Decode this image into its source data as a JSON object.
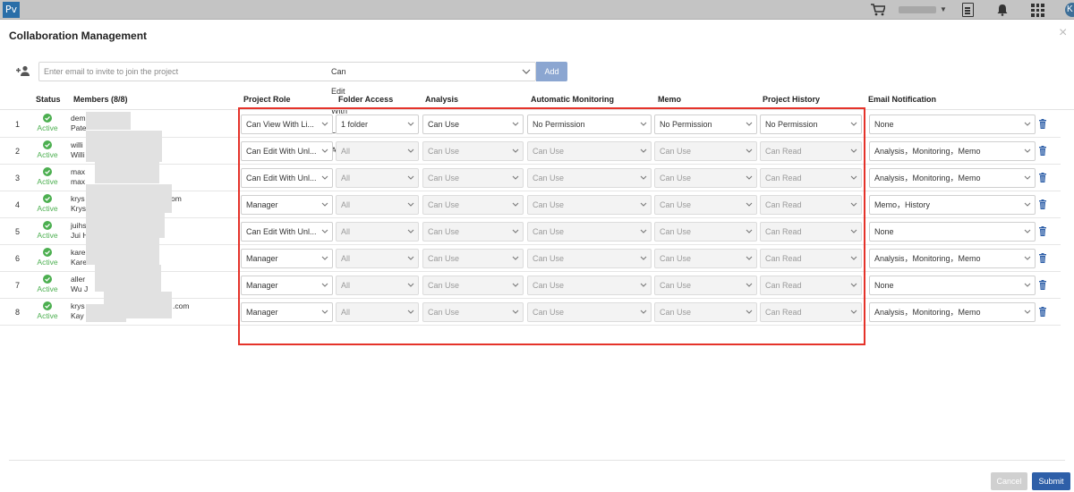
{
  "topbar": {
    "logo_text": "Pv",
    "avatar_letter": "K",
    "icons": [
      "cart-icon",
      "chevron-down-icon",
      "document-icon",
      "bell-icon",
      "apps-grid-icon"
    ]
  },
  "modal": {
    "title": "Collaboration Management",
    "close_label": "×"
  },
  "invite": {
    "placeholder": "Enter email to invite to join the project",
    "permission": "Can Edit With Limited Access",
    "add_label": "Add"
  },
  "table": {
    "headers": {
      "status": "Status",
      "members": "Members (8/8)",
      "project_role": "Project Role",
      "folder_access": "Folder Access",
      "analysis": "Analysis",
      "automatic_monitoring": "Automatic Monitoring",
      "memo": "Memo",
      "project_history": "Project History",
      "email_notification": "Email Notification"
    },
    "rows": [
      {
        "index": "1",
        "status": "Active",
        "line1": "dem",
        "line2": "Pate",
        "role": "Can View With Li...",
        "folder": "1 folder",
        "analysis": "Can Use",
        "monitoring": "No Permission",
        "memo": "No Permission",
        "history": "No Permission",
        "email": "None"
      },
      {
        "index": "2",
        "status": "Active",
        "line1": "willi",
        "line2": "Willi",
        "role": "Can Edit With Unl...",
        "folder": "All",
        "analysis": "Can Use",
        "monitoring": "Can Use",
        "memo": "Can Use",
        "history": "Can Read",
        "email": "Analysis，Monitoring，Memo"
      },
      {
        "index": "3",
        "status": "Active",
        "line1": "max",
        "line2": "max",
        "role": "Can Edit With Unl...",
        "folder": "All",
        "analysis": "Can Use",
        "monitoring": "Can Use",
        "memo": "Can Use",
        "history": "Can Read",
        "email": "Analysis，Monitoring，Memo"
      },
      {
        "index": "4",
        "status": "Active",
        "line1": "krys",
        "line1_tail": "om",
        "line2": "Krys",
        "role": "Manager",
        "folder": "All",
        "analysis": "Can Use",
        "monitoring": "Can Use",
        "memo": "Can Use",
        "history": "Can Read",
        "email": "Memo，History"
      },
      {
        "index": "5",
        "status": "Active",
        "line1": "juihs",
        "line2": "Jui H",
        "role": "Can Edit With Unl...",
        "folder": "All",
        "analysis": "Can Use",
        "monitoring": "Can Use",
        "memo": "Can Use",
        "history": "Can Read",
        "email": "None"
      },
      {
        "index": "6",
        "status": "Active",
        "line1": "kare",
        "line2": "Kare",
        "role": "Manager",
        "folder": "All",
        "analysis": "Can Use",
        "monitoring": "Can Use",
        "memo": "Can Use",
        "history": "Can Read",
        "email": "Analysis，Monitoring，Memo"
      },
      {
        "index": "7",
        "status": "Active",
        "line1": "aller",
        "line2": "Wu J",
        "role": "Manager",
        "folder": "All",
        "analysis": "Can Use",
        "monitoring": "Can Use",
        "memo": "Can Use",
        "history": "Can Read",
        "email": "None"
      },
      {
        "index": "8",
        "status": "Active",
        "line1": "krys",
        "line1_tail": ".com",
        "line2": "Kay",
        "role": "Manager",
        "folder": "All",
        "analysis": "Can Use",
        "monitoring": "Can Use",
        "memo": "Can Use",
        "history": "Can Read",
        "email": "Analysis，Monitoring，Memo"
      }
    ]
  },
  "footer": {
    "cancel_label": "Cancel",
    "submit_label": "Submit"
  },
  "colors": {
    "accent": "#2e5fa8",
    "add_button": "#8ba6d1",
    "active_status": "#4caf50",
    "highlight_box": "#e5332a"
  }
}
